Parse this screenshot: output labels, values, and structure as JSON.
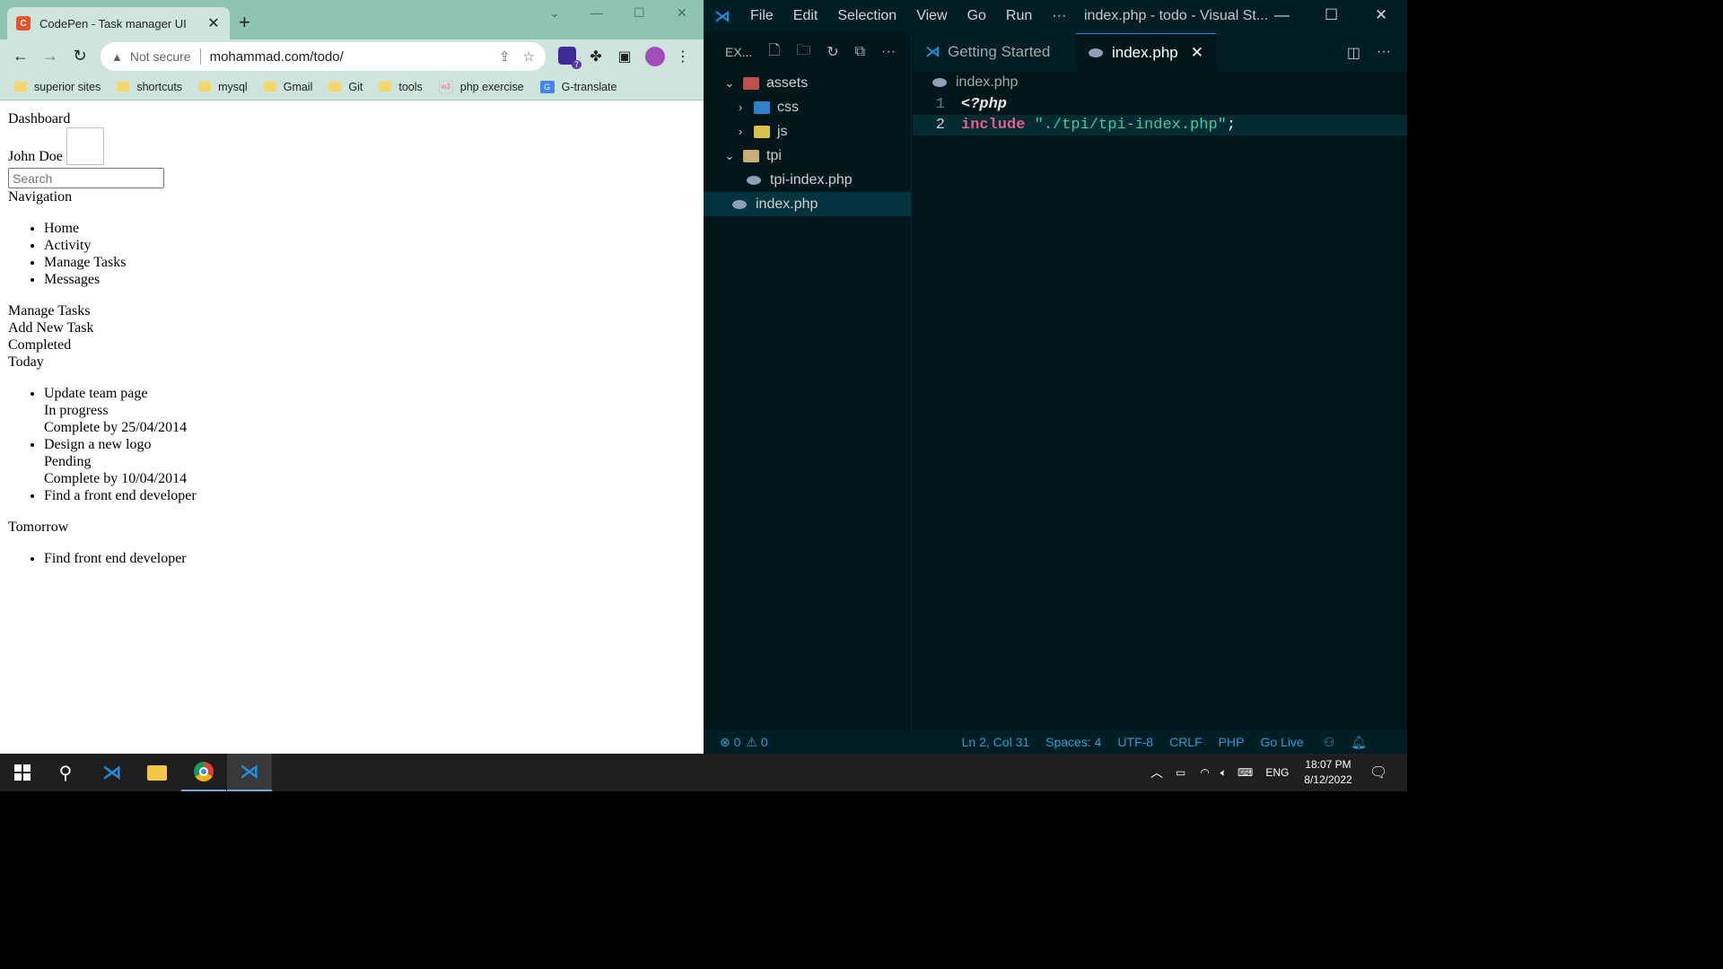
{
  "chrome": {
    "tab_title": "CodePen - Task manager UI",
    "tab_close": "✕",
    "new_tab": "+",
    "win_controls": {
      "minimize": "—",
      "maximize": "☐",
      "close": "✕",
      "dropdown": "⌄"
    },
    "nav": {
      "back": "←",
      "forward": "→",
      "reload": "↻"
    },
    "omnibox": {
      "not_secure": "Not secure",
      "url": "mohammad.com/todo/",
      "share": "⇪",
      "star": "☆"
    },
    "toolbar": {
      "extension_badge": "7",
      "puzzle": "✤",
      "sidebar": "▣",
      "menu": "⋮"
    },
    "bookmarks": [
      {
        "label": "superior sites",
        "icon": "folder"
      },
      {
        "label": "shortcuts",
        "icon": "folder"
      },
      {
        "label": "mysql",
        "icon": "folder"
      },
      {
        "label": "Gmail",
        "icon": "folder"
      },
      {
        "label": "Git",
        "icon": "folder"
      },
      {
        "label": "tools",
        "icon": "folder"
      },
      {
        "label": "php exercise",
        "icon": "w3"
      },
      {
        "label": "G-translate",
        "icon": "gtranslate"
      }
    ]
  },
  "page": {
    "dashboard": "Dashboard",
    "user_name": "John Doe",
    "search_placeholder": "Search",
    "navigation_label": "Navigation",
    "nav_items": [
      "Home",
      "Activity",
      "Manage Tasks",
      "Messages"
    ],
    "manage_tasks": "Manage Tasks",
    "add_new_task": "Add New Task",
    "completed": "Completed",
    "today_label": "Today",
    "today_tasks": [
      {
        "title": "Update team page",
        "status": "In progress",
        "due": "Complete by 25/04/2014"
      },
      {
        "title": "Design a new logo",
        "status": "Pending",
        "due": "Complete by 10/04/2014"
      },
      {
        "title": "Find a front end developer",
        "status": "",
        "due": ""
      }
    ],
    "tomorrow_label": "Tomorrow",
    "tomorrow_tasks": [
      "Find front end developer"
    ]
  },
  "vscode": {
    "menu": [
      "File",
      "Edit",
      "Selection",
      "View",
      "Go",
      "Run",
      "···"
    ],
    "window_title": "index.php - todo - Visual St...",
    "win_controls": {
      "minimize": "—",
      "maximize": "☐",
      "close": "✕"
    },
    "explorer_title": "EX...",
    "explorer_actions": {
      "new_file": "🗋",
      "new_folder": "🗀",
      "refresh": "↻",
      "collapse": "⧉",
      "more": "···"
    },
    "tree": [
      {
        "label": "assets",
        "chevron": "⌄",
        "indent": 0,
        "icon": "assets"
      },
      {
        "label": "css",
        "chevron": "›",
        "indent": 1,
        "icon": "css"
      },
      {
        "label": "js",
        "chevron": "›",
        "indent": 1,
        "icon": "js"
      },
      {
        "label": "tpi",
        "chevron": "⌄",
        "indent": 0,
        "icon": "tpi"
      },
      {
        "label": "tpi-index.php",
        "chevron": "",
        "indent": 2,
        "icon": "php"
      },
      {
        "label": "index.php",
        "chevron": "",
        "indent": 1,
        "icon": "php",
        "selected": true
      }
    ],
    "tabs": [
      {
        "label": "Getting Started",
        "active": false
      },
      {
        "label": "index.php",
        "active": true,
        "close": "✕"
      }
    ],
    "editor_actions": {
      "split": "◫",
      "more": "···"
    },
    "breadcrumb": "index.php",
    "code": [
      {
        "num": "1",
        "parts": [
          {
            "cls": "kw-tag",
            "text": "<?php"
          }
        ]
      },
      {
        "num": "2",
        "current": true,
        "parts": [
          {
            "cls": "kw-inc",
            "text": "include"
          },
          {
            "cls": "punc",
            "text": " "
          },
          {
            "cls": "str",
            "text": "\"./tpi/tpi-index.php\""
          },
          {
            "cls": "punc",
            "text": ";"
          }
        ]
      }
    ],
    "status": {
      "errors": "⊗ 0",
      "warnings": "⚠ 0",
      "position": "Ln 2, Col 31",
      "spaces": "Spaces: 4",
      "encoding": "UTF-8",
      "eol": "CRLF",
      "language": "PHP",
      "go_live": "Go Live"
    }
  },
  "taskbar": {
    "search_icon": "⚲",
    "language": "ENG",
    "time": "18:07 PM",
    "date": "8/12/2022"
  }
}
